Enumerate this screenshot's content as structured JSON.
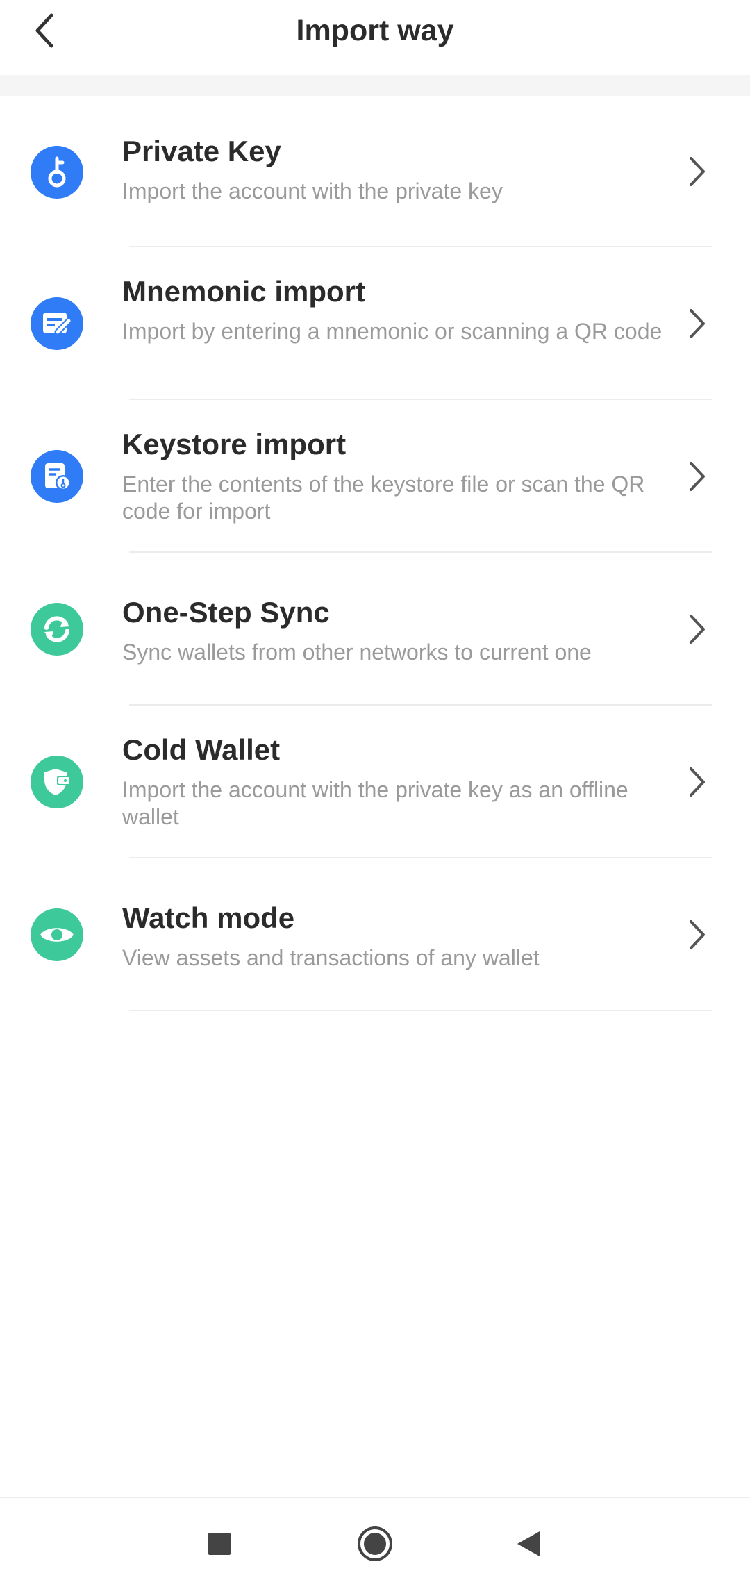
{
  "header": {
    "title": "Import way",
    "back_icon": "chevron-left-icon"
  },
  "colors": {
    "blue": "#2f7cf6",
    "green": "#3ec99a",
    "title_text": "#2b2b2b",
    "desc_text": "#9a9a9a"
  },
  "items": [
    {
      "title": "Private Key",
      "description": "Import the account with the private key",
      "icon": "key-icon",
      "color": "#2f7cf6"
    },
    {
      "title": "Mnemonic import",
      "description": "Import by entering a mnemonic or scanning a QR code",
      "icon": "edit-card-icon",
      "color": "#2f7cf6"
    },
    {
      "title": "Keystore import",
      "description": "Enter the contents of the keystore file or scan the QR code for import",
      "icon": "keystore-file-icon",
      "color": "#2f7cf6"
    },
    {
      "title": "One-Step Sync",
      "description": "Sync wallets from other networks to current one",
      "icon": "sync-icon",
      "color": "#3ec99a"
    },
    {
      "title": "Cold Wallet",
      "description": "Import the account with the private key as an offline wallet",
      "icon": "cold-wallet-icon",
      "color": "#3ec99a"
    },
    {
      "title": "Watch mode",
      "description": "View assets and transactions of any wallet",
      "icon": "eye-icon",
      "color": "#3ec99a"
    }
  ],
  "navbar": {
    "recents_icon": "square-icon",
    "home_icon": "circle-home-icon",
    "back_icon": "triangle-back-icon"
  }
}
